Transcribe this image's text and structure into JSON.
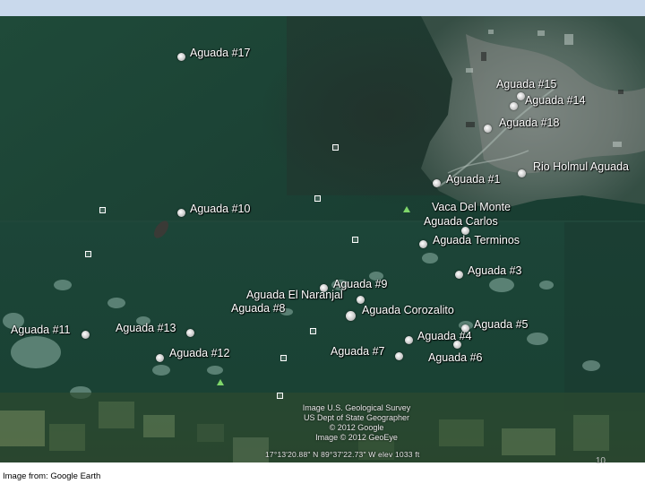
{
  "map": {
    "labels": {
      "aguada_17": "Aguada #17",
      "aguada_15": "Aguada #15",
      "aguada_14": "Aguada #14",
      "aguada_18": "Aguada #18",
      "rio_holmul": "Rio Holmul Aguada",
      "aguada_1": "Aguada #1",
      "aguada_10": "Aguada #10",
      "vaca_del_monte": "Vaca Del Monte",
      "aguada_carlos": "Aguada Carlos",
      "aguada_terminos": "Aguada Terminos",
      "aguada_3": "Aguada #3",
      "aguada_9": "Aguada #9",
      "aguada_el_naranjal": "Aguada El Naranjal",
      "aguada_8": "Aguada #8",
      "aguada_corozalito": "Aguada Corozalito",
      "aguada_5": "Aguada #5",
      "aguada_11": "Aguada #11",
      "aguada_13": "Aguada #13",
      "aguada_4": "Aguada #4",
      "aguada_7": "Aguada #7",
      "aguada_12": "Aguada #12",
      "aguada_6": "Aguada #6"
    },
    "attribution": {
      "line1": "Image U.S. Geological Survey",
      "line2": "US Dept of State Geographer",
      "line3": "© 2012 Google",
      "line4": "Image © 2012 GeoEye"
    },
    "coordinates": "17°13'20.88\" N  89°37'22.73\" W  elev  1033 ft"
  },
  "slide_number": "10",
  "caption": "Image from: Google Earth"
}
